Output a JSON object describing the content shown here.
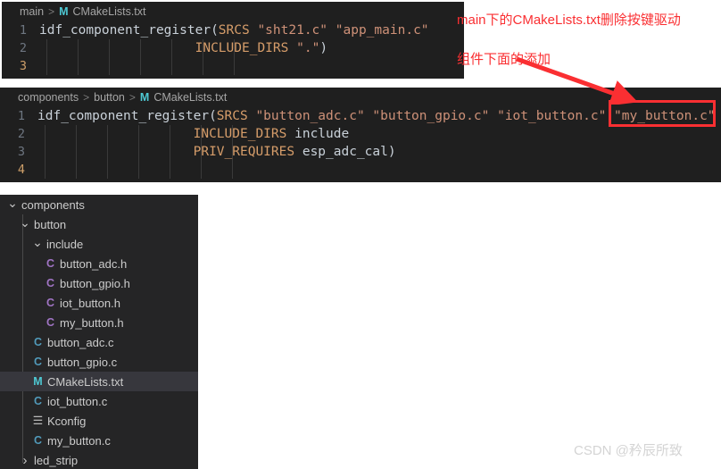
{
  "editors": [
    {
      "id": "main-cmakelists",
      "breadcrumb": {
        "segments": [
          "main"
        ],
        "separator": ">",
        "file_icon": "M",
        "file_name": "CMakeLists.txt"
      },
      "lines": [
        {
          "number": "1",
          "tokens": [
            {
              "text": "idf_component_register",
              "cls": "t-fn"
            },
            {
              "text": "(",
              "cls": "t-punct"
            },
            {
              "text": "SRCS",
              "cls": "t-kw"
            },
            {
              "text": " ",
              "cls": "t-plain"
            },
            {
              "text": "\"sht21.c\"",
              "cls": "t-str"
            },
            {
              "text": " ",
              "cls": "t-plain"
            },
            {
              "text": "\"app_main.c\"",
              "cls": "t-str"
            }
          ]
        },
        {
          "number": "2",
          "tokens": [
            {
              "text": "                    ",
              "cls": "t-plain"
            },
            {
              "text": "INCLUDE_DIRS",
              "cls": "t-kw"
            },
            {
              "text": " ",
              "cls": "t-plain"
            },
            {
              "text": "\".\"",
              "cls": "t-str"
            },
            {
              "text": ")",
              "cls": "t-punct"
            }
          ]
        },
        {
          "number": "3",
          "tokens": []
        }
      ]
    },
    {
      "id": "button-cmakelists",
      "breadcrumb": {
        "segments": [
          "components",
          "button"
        ],
        "separator": ">",
        "file_icon": "M",
        "file_name": "CMakeLists.txt"
      },
      "lines": [
        {
          "number": "1",
          "tokens": [
            {
              "text": "idf_component_register",
              "cls": "t-fn"
            },
            {
              "text": "(",
              "cls": "t-punct"
            },
            {
              "text": "SRCS",
              "cls": "t-kw"
            },
            {
              "text": " ",
              "cls": "t-plain"
            },
            {
              "text": "\"button_adc.c\"",
              "cls": "t-str"
            },
            {
              "text": " ",
              "cls": "t-plain"
            },
            {
              "text": "\"button_gpio.c\"",
              "cls": "t-str"
            },
            {
              "text": " ",
              "cls": "t-plain"
            },
            {
              "text": "\"iot_button.c\"",
              "cls": "t-str"
            },
            {
              "text": " ",
              "cls": "t-plain"
            },
            {
              "text": "\"my_button.c\"",
              "cls": "t-str"
            }
          ]
        },
        {
          "number": "2",
          "tokens": [
            {
              "text": "                    ",
              "cls": "t-plain"
            },
            {
              "text": "INCLUDE_DIRS",
              "cls": "t-kw"
            },
            {
              "text": " ",
              "cls": "t-plain"
            },
            {
              "text": "include",
              "cls": "t-plain"
            }
          ]
        },
        {
          "number": "3",
          "tokens": [
            {
              "text": "                    ",
              "cls": "t-plain"
            },
            {
              "text": "PRIV_REQUIRES",
              "cls": "t-kw"
            },
            {
              "text": " ",
              "cls": "t-plain"
            },
            {
              "text": "esp_adc_cal",
              "cls": "t-plain"
            },
            {
              "text": ")",
              "cls": "t-punct"
            }
          ]
        },
        {
          "number": "4",
          "tokens": []
        }
      ]
    }
  ],
  "file_tree": {
    "items": [
      {
        "label": "components",
        "indent": 0,
        "chevron": "expanded",
        "icon": null,
        "selected": false
      },
      {
        "label": "button",
        "indent": 1,
        "chevron": "expanded",
        "icon": null,
        "selected": false
      },
      {
        "label": "include",
        "indent": 2,
        "chevron": "expanded",
        "icon": null,
        "selected": false
      },
      {
        "label": "button_adc.h",
        "indent": 3,
        "chevron": null,
        "icon": "C",
        "icon_kind": "header",
        "selected": false
      },
      {
        "label": "button_gpio.h",
        "indent": 3,
        "chevron": null,
        "icon": "C",
        "icon_kind": "header",
        "selected": false
      },
      {
        "label": "iot_button.h",
        "indent": 3,
        "chevron": null,
        "icon": "C",
        "icon_kind": "header",
        "selected": false
      },
      {
        "label": "my_button.h",
        "indent": 3,
        "chevron": null,
        "icon": "C",
        "icon_kind": "header",
        "selected": false
      },
      {
        "label": "button_adc.c",
        "indent": 2,
        "chevron": null,
        "icon": "C",
        "icon_kind": "source",
        "selected": false
      },
      {
        "label": "button_gpio.c",
        "indent": 2,
        "chevron": null,
        "icon": "C",
        "icon_kind": "source",
        "selected": false
      },
      {
        "label": "CMakeLists.txt",
        "indent": 2,
        "chevron": null,
        "icon": "M",
        "icon_kind": "cmake",
        "selected": true
      },
      {
        "label": "iot_button.c",
        "indent": 2,
        "chevron": null,
        "icon": "C",
        "icon_kind": "source",
        "selected": false
      },
      {
        "label": "Kconfig",
        "indent": 2,
        "chevron": null,
        "icon": "☰",
        "icon_kind": "kconfig",
        "selected": false
      },
      {
        "label": "my_button.c",
        "indent": 2,
        "chevron": null,
        "icon": "C",
        "icon_kind": "source",
        "selected": false
      },
      {
        "label": "led_strip",
        "indent": 1,
        "chevron": "collapsed",
        "icon": null,
        "selected": false
      }
    ]
  },
  "annotations": {
    "line1": "main下的CMakeLists.txt删除按键驱动",
    "line2": "组件下面的添加",
    "color": "#fa2f32",
    "highlight_target": "\"my_button.c\""
  },
  "watermark": "CSDN @矜辰所致"
}
